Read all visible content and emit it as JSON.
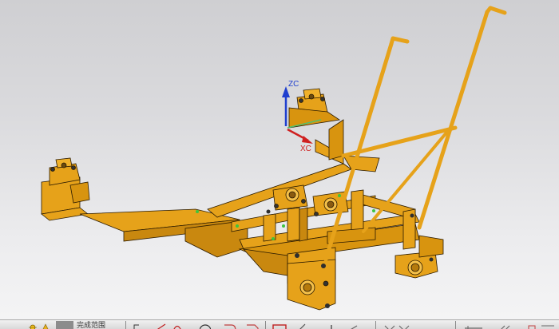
{
  "viewport": {
    "axes": {
      "z_label": "ZC",
      "x_label": "XC",
      "z_color": "#1f3fcf",
      "x_color": "#cf2020",
      "y_color": "#4fc070"
    },
    "model": {
      "body_color": "#e6a21a",
      "shade_color": "#b57a0c",
      "edge_color": "#2a1a00",
      "marker_color": "#3ec43e"
    },
    "background": {
      "top": "#cfcfd2",
      "bottom": "#f4f4f5"
    }
  },
  "toolbar": {
    "selection_scope_label": "完成范围",
    "icons": [
      {
        "name": "snap-point-icon"
      },
      {
        "name": "selection-filter-icon"
      },
      {
        "name": "arrow-icon"
      },
      {
        "name": "line-icon"
      },
      {
        "name": "arc-icon"
      },
      {
        "name": "circle-icon"
      },
      {
        "name": "fillet-icon"
      },
      {
        "name": "chamfer-icon"
      },
      {
        "name": "rectangle-icon"
      },
      {
        "name": "trim-icon"
      },
      {
        "name": "offset-icon"
      },
      {
        "name": "mirror-icon"
      },
      {
        "name": "project-icon"
      }
    ]
  }
}
